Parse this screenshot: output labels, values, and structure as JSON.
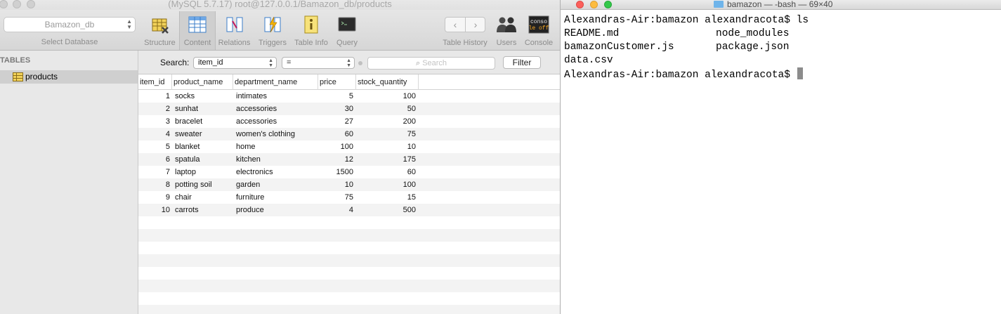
{
  "sequel": {
    "window_title": "(MySQL 5.7.17) root@127.0.0.1/Bamazon_db/products",
    "database": {
      "selected": "Bamazon_db",
      "caption": "Select Database"
    },
    "toolbar": {
      "structure": "Structure",
      "content": "Content",
      "relations": "Relations",
      "triggers": "Triggers",
      "table_info": "Table Info",
      "query": "Query",
      "table_history": "Table History",
      "users": "Users",
      "console": "Console",
      "console_icon_text": [
        "conso",
        "le off"
      ]
    },
    "sidebar": {
      "header": "TABLES",
      "items": [
        {
          "label": "products"
        }
      ]
    },
    "filter": {
      "search_label": "Search:",
      "column": "item_id",
      "operator": "=",
      "search_placeholder": "Search",
      "filter_button": "Filter"
    },
    "grid": {
      "columns": [
        "item_id",
        "product_name",
        "department_name",
        "price",
        "stock_quantity"
      ],
      "rows": [
        [
          "1",
          "socks",
          "intimates",
          "5",
          "100"
        ],
        [
          "2",
          "sunhat",
          "accessories",
          "30",
          "50"
        ],
        [
          "3",
          "bracelet",
          "accessories",
          "27",
          "200"
        ],
        [
          "4",
          "sweater",
          "women's clothing",
          "60",
          "75"
        ],
        [
          "5",
          "blanket",
          "home",
          "100",
          "10"
        ],
        [
          "6",
          "spatula",
          "kitchen",
          "12",
          "175"
        ],
        [
          "7",
          "laptop",
          "electronics",
          "1500",
          "60"
        ],
        [
          "8",
          "potting soil",
          "garden",
          "10",
          "100"
        ],
        [
          "9",
          "chair",
          "furniture",
          "75",
          "15"
        ],
        [
          "10",
          "carrots",
          "produce",
          "4",
          "500"
        ]
      ]
    }
  },
  "terminal": {
    "window_title": "bamazon — -bash — 69×40",
    "prompt": "Alexandras-Air:bamazon alexandracota$",
    "command": "ls",
    "listing": [
      [
        "README.md",
        "node_modules"
      ],
      [
        "bamazonCustomer.js",
        "package.json"
      ],
      [
        "data.csv",
        ""
      ]
    ],
    "colors": {
      "close": "#fc605c",
      "minimize": "#fdbc40",
      "zoom": "#34c84a"
    }
  }
}
